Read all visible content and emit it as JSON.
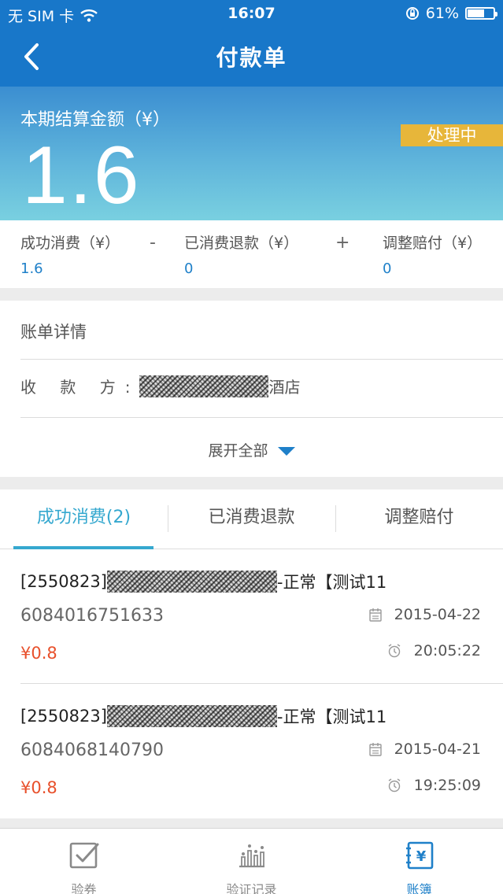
{
  "status_bar": {
    "carrier": "无 SIM 卡",
    "time": "16:07",
    "battery": "61%",
    "battery_level": 0.61
  },
  "nav": {
    "title": "付款单"
  },
  "summary": {
    "label": "本期结算金额（¥）",
    "amount": "1.6",
    "status": "处理中"
  },
  "breakdown": {
    "items": [
      {
        "label": "成功消费（¥）",
        "value": "1.6"
      },
      {
        "label": "已消费退款（¥）",
        "value": "0"
      },
      {
        "label": "调整赔付（¥）",
        "value": "0"
      }
    ],
    "ops": [
      "-",
      "+"
    ]
  },
  "details": {
    "title": "账单详情",
    "payee_label": "收 款 方:",
    "payee_suffix": "酒店",
    "expand_label": "展开全部"
  },
  "tabs": [
    {
      "label": "成功消费(2)",
      "active": true
    },
    {
      "label": "已消费退款",
      "active": false
    },
    {
      "label": "调整赔付",
      "active": false
    }
  ],
  "records": [
    {
      "id": "[2550823]",
      "suffix": "-正常【测试11",
      "code": "6084016751633",
      "price": "¥0.8",
      "date": "2015-04-22",
      "time": "20:05:22"
    },
    {
      "id": "[2550823]",
      "suffix": "-正常【测试11",
      "code": "6084068140790",
      "price": "¥0.8",
      "date": "2015-04-21",
      "time": "19:25:09"
    }
  ],
  "tabbar": [
    {
      "label": "验券",
      "icon": "check-ticket-icon",
      "active": false
    },
    {
      "label": "验证记录",
      "icon": "chart-icon",
      "active": false
    },
    {
      "label": "账簿",
      "icon": "ledger-icon",
      "active": true
    }
  ],
  "colors": {
    "header_blue": "#1877c9",
    "accent_blue": "#1f80c9",
    "tab_active": "#35a8cf",
    "badge_gold": "#e7b63a",
    "price_red": "#e8502b"
  }
}
